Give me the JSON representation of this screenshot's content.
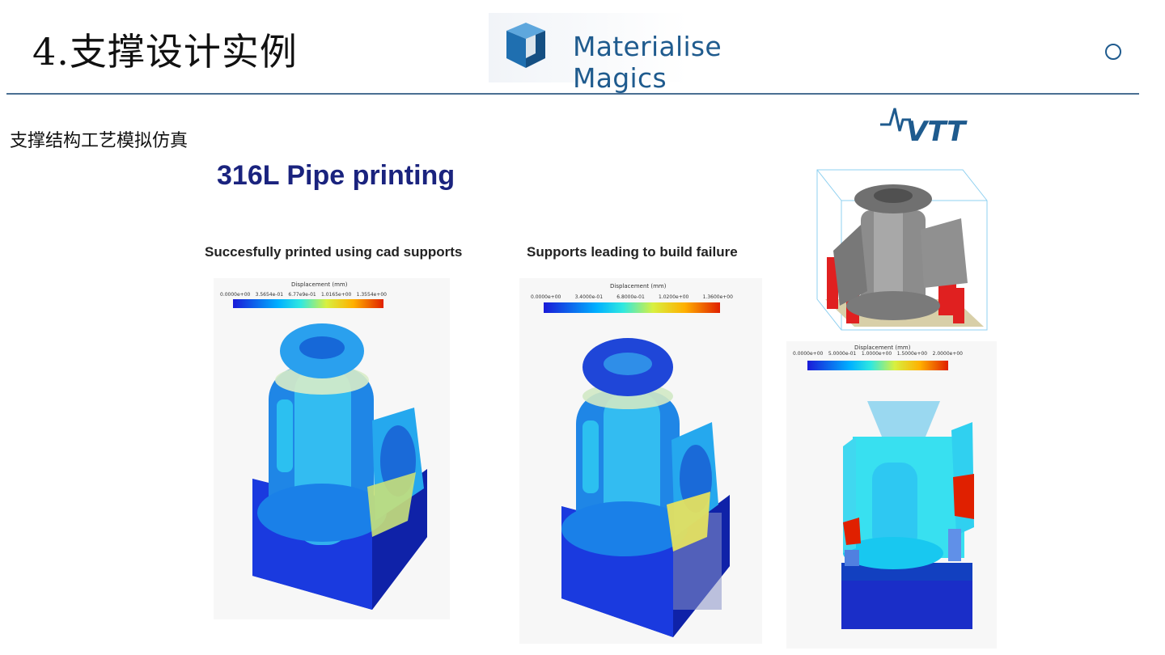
{
  "slide": {
    "title": "4.支撑设计实例",
    "subtitle": "支撑结构工艺模拟仿真"
  },
  "logo": {
    "text": "Materialise Magics",
    "color": "#1f5b8e"
  },
  "vtt_logo": {
    "text": "VTT",
    "color": "#1f5b8e"
  },
  "figure": {
    "title": "316L Pipe printing",
    "captions": {
      "success": "Succesfully printed using cad supports",
      "failure": "Supports leading to build failure"
    }
  },
  "panels": {
    "success": {
      "colorbar_title": "Displacement (mm)",
      "ticks": [
        "0.0000e+00",
        "3.5654e-01",
        "6.77e9e-01",
        "1.0165e+00",
        "1.3554e+00"
      ]
    },
    "failure": {
      "colorbar_title": "Displacement (mm)",
      "ticks": [
        "0.0000e+00",
        "3.4000e-01",
        "6.8000e-01",
        "1.0200e+00",
        "1.3600e+00"
      ]
    },
    "section": {
      "colorbar_title": "Displacement (mm)",
      "ticks": [
        "0.0000e+00",
        "5.0000e-01",
        "1.0000e+00",
        "1.5000e+00",
        "2.0000e+00"
      ]
    }
  }
}
